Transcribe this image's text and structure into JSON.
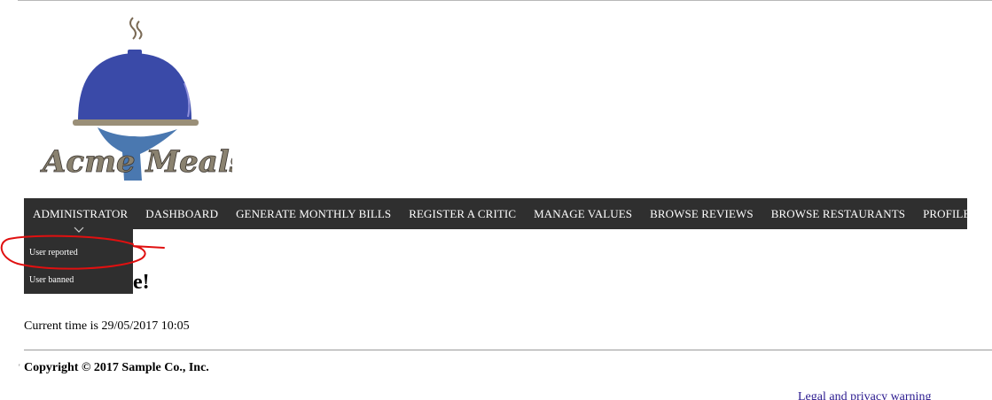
{
  "logo": {
    "text": "Acme Meals"
  },
  "nav": {
    "items": [
      "ADMINISTRATOR",
      "DASHBOARD",
      "GENERATE MONTHLY BILLS",
      "REGISTER A CRITIC",
      "MANAGE VALUES",
      "BROWSE REVIEWS",
      "BROWSE RESTAURANTS",
      "PROFILE (ADMIN)"
    ]
  },
  "dropdown": {
    "items": [
      "User reported",
      "User banned"
    ]
  },
  "main": {
    "welcome_fragment": "e!",
    "current_time": "Current time is 29/05/2017 10:05"
  },
  "footer": {
    "copyright": "Copyright © 2017 Sample Co., Inc.",
    "legal": "Legal and privacy warning"
  },
  "colors": {
    "navbar_bg": "#2f2f2f",
    "dome_blue": "#3a4aa8",
    "hand_blue": "#4a78b0",
    "annotation_red": "#e01010"
  }
}
